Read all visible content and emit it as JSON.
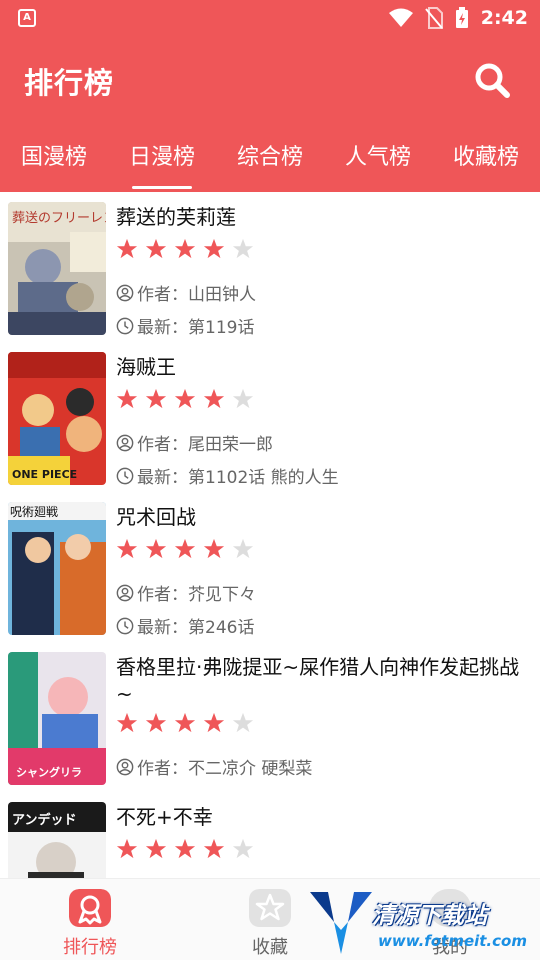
{
  "status_bar": {
    "time": "2:42",
    "app_badge": "A"
  },
  "header": {
    "title": "排行榜"
  },
  "tabs": [
    {
      "label": "国漫榜"
    },
    {
      "label": "日漫榜"
    },
    {
      "label": "综合榜"
    },
    {
      "label": "人气榜"
    },
    {
      "label": "收藏榜"
    }
  ],
  "active_tab": "日漫榜",
  "labels": {
    "author_prefix": "作者：",
    "latest_prefix": "最新："
  },
  "items": [
    {
      "title": "葬送的芙莉莲",
      "rating": 4,
      "max_rating": 5,
      "author": "山田钟人",
      "latest": "第119话"
    },
    {
      "title": "海贼王",
      "rating": 4,
      "max_rating": 5,
      "author": "尾田荣一郎",
      "latest": "第1102话 熊的人生"
    },
    {
      "title": "咒术回战",
      "rating": 4,
      "max_rating": 5,
      "author": "芥见下々",
      "latest": "第246话"
    },
    {
      "title": "香格里拉·弗陇提亚~屎作猎人向神作发起挑战~",
      "rating": 4,
      "max_rating": 5,
      "author": "不二凉介 硬梨菜",
      "latest": ""
    },
    {
      "title": "不死+不幸",
      "rating": 4,
      "max_rating": 5,
      "author": "",
      "latest": ""
    }
  ],
  "cover_texts": [
    "葬送のフリーレン",
    "ONE PIECE",
    "呪術廻戦",
    "シャングリラ",
    "アンデッド"
  ],
  "bottom_nav": [
    {
      "label": "排行榜",
      "icon": "ranking-icon",
      "active": true
    },
    {
      "label": "收藏",
      "icon": "star-icon",
      "active": false
    },
    {
      "label": "我的",
      "icon": "profile-icon",
      "active": false
    }
  ],
  "watermark": {
    "text": "清源下载站",
    "url": "www.fotmeit.com"
  },
  "colors": {
    "accent": "#ef5658",
    "star_on": "#ef5658",
    "star_off": "#dddddd",
    "nav_inactive": "#666666"
  }
}
